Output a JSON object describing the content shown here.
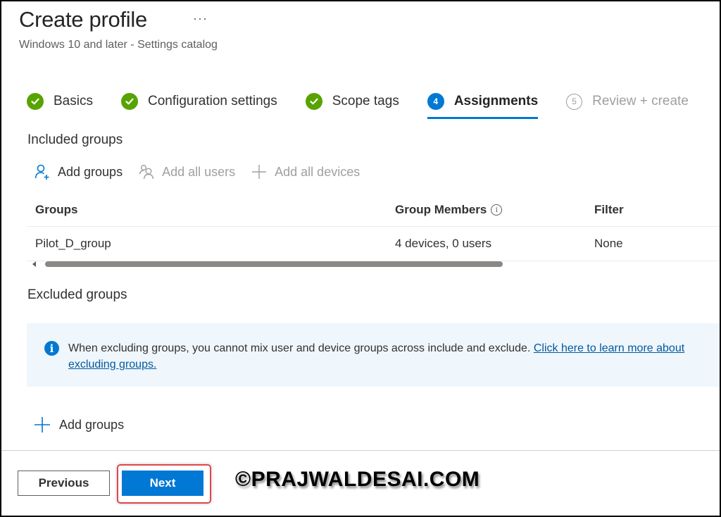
{
  "header": {
    "title": "Create profile",
    "more_label": "···",
    "subtitle": "Windows 10 and later - Settings catalog"
  },
  "wizard": {
    "steps": [
      {
        "number": "1",
        "label": "Basics",
        "state": "completed"
      },
      {
        "number": "2",
        "label": "Configuration settings",
        "state": "completed"
      },
      {
        "number": "3",
        "label": "Scope tags",
        "state": "completed"
      },
      {
        "number": "4",
        "label": "Assignments",
        "state": "current"
      },
      {
        "number": "5",
        "label": "Review + create",
        "state": "upcoming"
      }
    ]
  },
  "included": {
    "heading": "Included groups",
    "commands": [
      {
        "label": "Add groups",
        "icon": "add-group-icon",
        "enabled": true
      },
      {
        "label": "Add all users",
        "icon": "users-icon",
        "enabled": false
      },
      {
        "label": "Add all devices",
        "icon": "plus-icon",
        "enabled": false
      }
    ],
    "table": {
      "columns": [
        "Groups",
        "Group Members",
        "Filter"
      ],
      "rows": [
        {
          "group": "Pilot_D_group",
          "members": "4 devices, 0 users",
          "filter": "None"
        }
      ]
    }
  },
  "excluded": {
    "heading": "Excluded groups",
    "info_message": "When excluding groups, you cannot mix user and device groups across include and exclude. ",
    "info_link": "Click here to learn more about excluding groups.",
    "add_label": "Add groups"
  },
  "footer": {
    "previous_label": "Previous",
    "next_label": "Next"
  },
  "watermark": "©PRAJWALDESAI.COM",
  "colors": {
    "accent": "#0078d4",
    "success": "#57a300",
    "info_bg": "#eff6fc",
    "highlight": "#e0474a"
  }
}
